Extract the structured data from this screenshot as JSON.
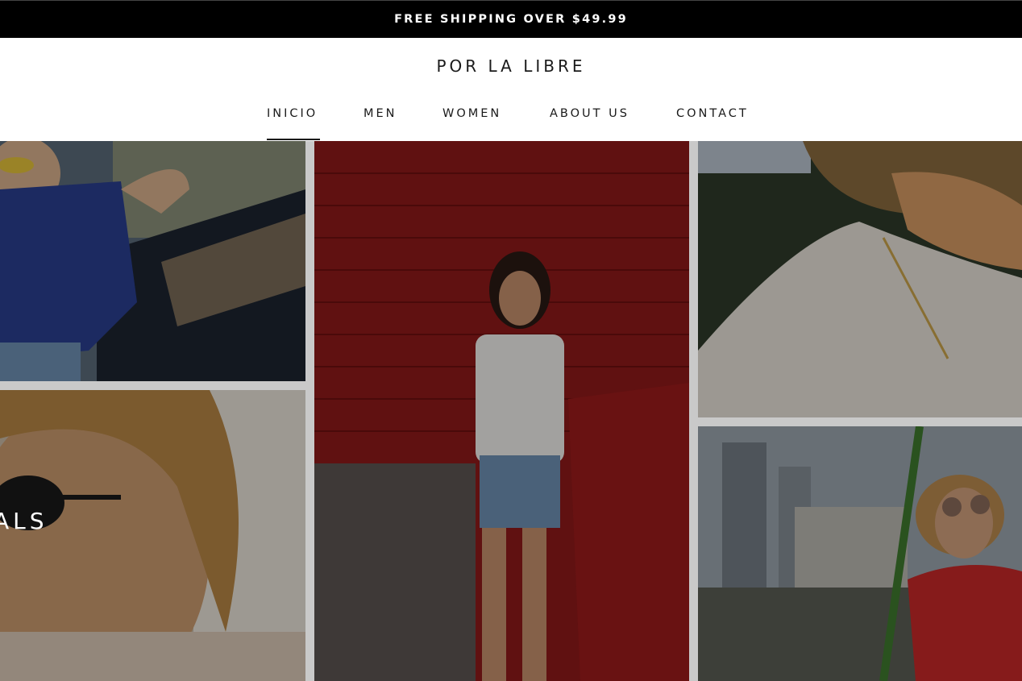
{
  "announcement": {
    "text": "FREE SHIPPING OVER $49.99"
  },
  "header": {
    "logo": "POR LA LIBRE"
  },
  "nav": {
    "items": [
      {
        "label": "INICIO",
        "active": true
      },
      {
        "label": "MEN",
        "active": false
      },
      {
        "label": "WOMEN",
        "active": false
      },
      {
        "label": "ABOUT US",
        "active": false
      },
      {
        "label": "CONTACT",
        "active": false
      }
    ]
  },
  "hero": {
    "heading": "ALS",
    "tiles": [
      {
        "subject": "woman in blue printed shirt with yellow sunglasses"
      },
      {
        "subject": "man with sunglasses and windblown hair"
      },
      {
        "subject": "woman in white shirt and denim shorts against red brick wall"
      },
      {
        "subject": "man in white shirt with necklace at sunset"
      },
      {
        "subject": "smiling woman with round sunglasses on a swing, city background"
      }
    ],
    "colors": {
      "overlay": "#000000",
      "brick_red": "#8e1a1a",
      "shirt_blue": "#2a3f8f"
    }
  }
}
